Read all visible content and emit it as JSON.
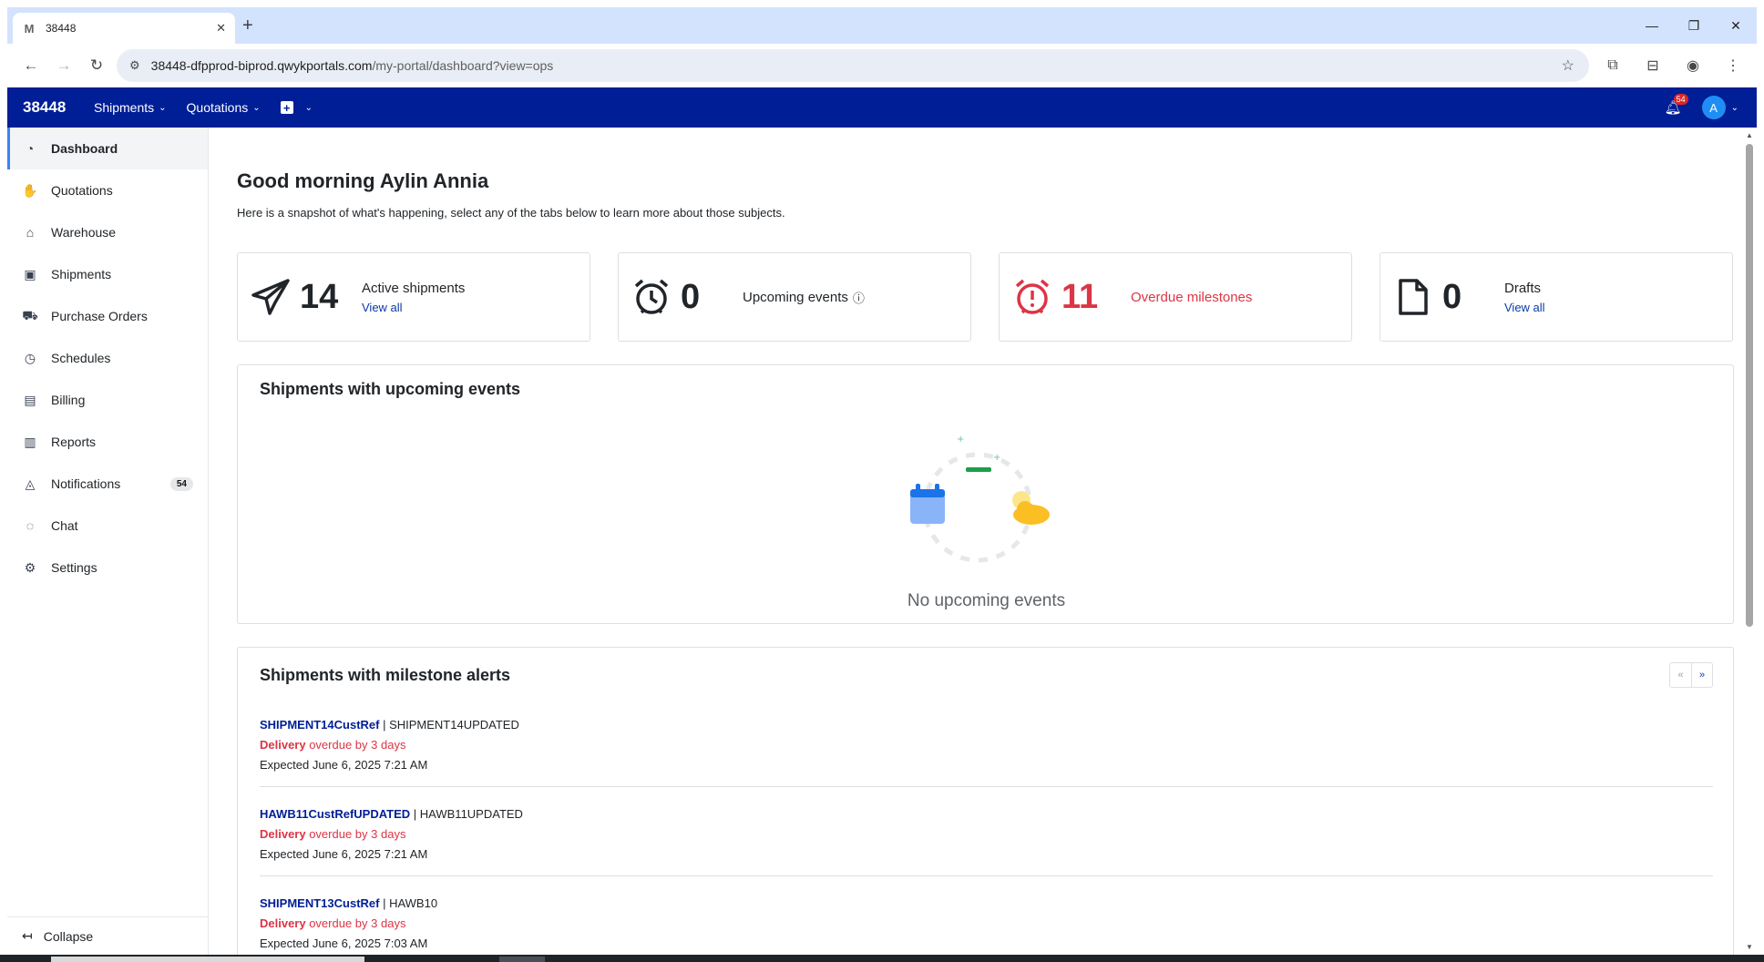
{
  "browser": {
    "tab_title": "38448",
    "tab_favicon": "M",
    "url_host": "38448-dfpprod-biprod.qwykportals.com",
    "url_path": "/my-portal/dashboard?view=ops"
  },
  "header": {
    "brand": "38448",
    "nav": [
      {
        "label": "Shipments"
      },
      {
        "label": "Quotations"
      }
    ],
    "notification_count": "54",
    "avatar_initial": "A"
  },
  "sidebar": {
    "items": [
      {
        "label": "Dashboard",
        "icon": "gauge-icon"
      },
      {
        "label": "Quotations",
        "icon": "hand-coins-icon"
      },
      {
        "label": "Warehouse",
        "icon": "warehouse-icon"
      },
      {
        "label": "Shipments",
        "icon": "package-icon"
      },
      {
        "label": "Purchase Orders",
        "icon": "cart-icon"
      },
      {
        "label": "Schedules",
        "icon": "clock-icon"
      },
      {
        "label": "Billing",
        "icon": "billing-icon"
      },
      {
        "label": "Reports",
        "icon": "bar-chart-icon"
      },
      {
        "label": "Notifications",
        "icon": "bell-icon",
        "count": "54"
      },
      {
        "label": "Chat",
        "icon": "chat-icon"
      },
      {
        "label": "Settings",
        "icon": "gear-icon"
      }
    ],
    "collapse_label": "Collapse"
  },
  "main": {
    "greeting": "Good morning Aylin Annia",
    "subtitle": "Here is a snapshot of what's happening, select any of the tabs below to learn more about those subjects.",
    "stats": [
      {
        "value": "14",
        "label": "Active shipments",
        "link": "View all",
        "icon": "paper-plane-icon"
      },
      {
        "value": "0",
        "label": "Upcoming events",
        "icon": "alarm-clock-icon"
      },
      {
        "value": "11",
        "label": "Overdue milestones",
        "icon": "alarm-alert-icon",
        "color": "#dc3545"
      },
      {
        "value": "0",
        "label": "Drafts",
        "link": "View all",
        "icon": "document-icon"
      }
    ],
    "upcoming_panel": {
      "title": "Shipments with upcoming events",
      "empty_text": "No upcoming events"
    },
    "alerts_panel": {
      "title": "Shipments with milestone alerts",
      "pager_prev": "«",
      "pager_next": "»",
      "rows": [
        {
          "ref": "SHIPMENT14CustRef",
          "sep": " | ",
          "secondary": "SHIPMENT14UPDATED",
          "milestone": "Delivery",
          "overdue": " overdue by 3 days",
          "expected": "Expected June 6, 2025 7:21 AM"
        },
        {
          "ref": "HAWB11CustRefUPDATED",
          "sep": " | ",
          "secondary": "HAWB11UPDATED",
          "milestone": "Delivery",
          "overdue": " overdue by 3 days",
          "expected": "Expected June 6, 2025 7:21 AM"
        },
        {
          "ref": "SHIPMENT13CustRef",
          "sep": " | ",
          "secondary": "HAWB10",
          "milestone": "Delivery",
          "overdue": " overdue by 3 days",
          "expected": "Expected June 6, 2025 7:03 AM"
        }
      ]
    }
  },
  "colors": {
    "header_bg": "#001e96",
    "accent": "#3b82f6",
    "danger": "#dc3545",
    "link": "#0b3aa6"
  }
}
